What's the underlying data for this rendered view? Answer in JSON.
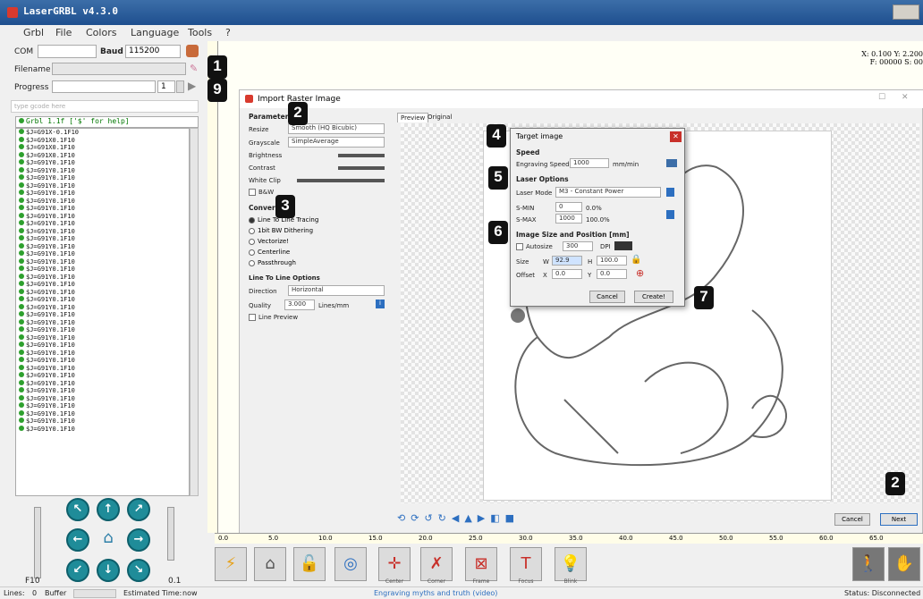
{
  "window": {
    "title": "LaserGRBL v4.3.0"
  },
  "menu": [
    "Grbl",
    "File",
    "Colors",
    "Language",
    "Tools",
    "?"
  ],
  "conn": {
    "com_label": "COM",
    "com_value": "",
    "baud_label": "Baud",
    "baud_value": "115200",
    "filename_label": "Filename",
    "progress_label": "Progress",
    "progress_count": "1"
  },
  "badges": {
    "b1": "1",
    "b9": "9",
    "b2a": "2",
    "b3": "3",
    "b4": "4",
    "b5": "5",
    "b6": "6",
    "b7": "7",
    "b2b": "2"
  },
  "console": {
    "placeholder": "type gcode here",
    "header": "Grbl 1.1f ['$' for help]",
    "lines": [
      "$J=G91X-0.1F10",
      "$J=G91X0.1F10",
      "$J=G91X0.1F10",
      "$J=G91X0.1F10",
      "$J=G91Y0.1F10",
      "$J=G91Y0.1F10",
      "$J=G91Y0.1F10",
      "$J=G91Y0.1F10",
      "$J=G91Y0.1F10",
      "$J=G91Y0.1F10",
      "$J=G91Y0.1F10",
      "$J=G91Y0.1F10",
      "$J=G91Y0.1F10",
      "$J=G91Y0.1F10",
      "$J=G91Y0.1F10",
      "$J=G91Y0.1F10",
      "$J=G91Y0.1F10",
      "$J=G91Y0.1F10",
      "$J=G91Y0.1F10",
      "$J=G91Y0.1F10",
      "$J=G91Y0.1F10",
      "$J=G91Y0.1F10",
      "$J=G91Y0.1F10",
      "$J=G91Y0.1F10",
      "$J=G91Y0.1F10",
      "$J=G91Y0.1F10",
      "$J=G91Y0.1F10",
      "$J=G91Y0.1F10",
      "$J=G91Y0.1F10",
      "$J=G91Y0.1F10",
      "$J=G91Y0.1F10",
      "$J=G91Y0.1F10",
      "$J=G91Y0.1F10",
      "$J=G91Y0.1F10",
      "$J=G91Y0.1F10",
      "$J=G91Y0.1F10",
      "$J=G91Y0.1F10",
      "$J=G91Y0.1F10",
      "$J=G91Y0.1F10",
      "$J=G91Y0.1F10"
    ]
  },
  "jog": {
    "f_label": "F10",
    "step_label": "0.1"
  },
  "coords": {
    "line1": "X: 0.100 Y: 2.200",
    "line2": "F: 00000 S: 00"
  },
  "import_dialog": {
    "title": "Import Raster Image",
    "parameters": "Parameters",
    "resize_label": "Resize",
    "resize_value": "Smooth (HQ Bicubic)",
    "grayscale_label": "Grayscale",
    "grayscale_value": "SimpleAverage",
    "brightness": "Brightness",
    "contrast": "Contrast",
    "white_clip": "White Clip",
    "bw": "B&W",
    "conversion": "Conversion",
    "conv_options": [
      "Line To Line Tracing",
      "1bit BW Dithering",
      "Vectorize!",
      "Centerline",
      "Passthrough"
    ],
    "l2l_title": "Line To Line Options",
    "direction_label": "Direction",
    "direction_value": "Horizontal",
    "quality_label": "Quality",
    "quality_value": "3.000",
    "quality_unit": "Lines/mm",
    "line_preview": "Line Preview",
    "tab_preview": "Preview",
    "tab_original": "Original",
    "cancel": "Cancel",
    "next": "Next"
  },
  "target": {
    "title": "Target image",
    "speed_section": "Speed",
    "engraving_speed_label": "Engraving Speed",
    "engraving_speed_value": "1000",
    "speed_unit": "mm/min",
    "laser_section": "Laser Options",
    "laser_mode_label": "Laser Mode",
    "laser_mode_value": "M3 - Constant Power",
    "smin_label": "S-MIN",
    "smin_value": "0",
    "smin_pct": "0.0%",
    "smax_label": "S-MAX",
    "smax_value": "1000",
    "smax_pct": "100.0%",
    "size_section": "Image Size and Position [mm]",
    "autosize": "Autosize",
    "dpi_value": "300",
    "dpi_label": "DPI",
    "size_label": "Size",
    "w_label": "W",
    "w_value": "92.9",
    "h_label": "H",
    "h_value": "100.0",
    "offset_label": "Offset",
    "x_label": "X",
    "x_value": "0.0",
    "y_label": "Y",
    "y_value": "0.0",
    "cancel": "Cancel",
    "create": "Create!"
  },
  "hruler_ticks": [
    "0.0",
    "5.0",
    "10.0",
    "15.0",
    "20.0",
    "25.0",
    "30.0",
    "35.0",
    "40.0",
    "45.0",
    "50.0",
    "55.0",
    "60.0",
    "65.0"
  ],
  "toolbar_labels": [
    "Center",
    "Corner",
    "Frame",
    "Focus",
    "Blink"
  ],
  "status": {
    "lines_label": "Lines:",
    "lines_value": "0",
    "buffer_label": "Buffer",
    "est_label": "Estimated Time:",
    "est_value": "now",
    "center_text": "Engraving myths and truth (video)",
    "status_text": "Status: Disconnected"
  },
  "colors": {
    "accent": "#1f8c99",
    "title": "#1e4f8f"
  }
}
